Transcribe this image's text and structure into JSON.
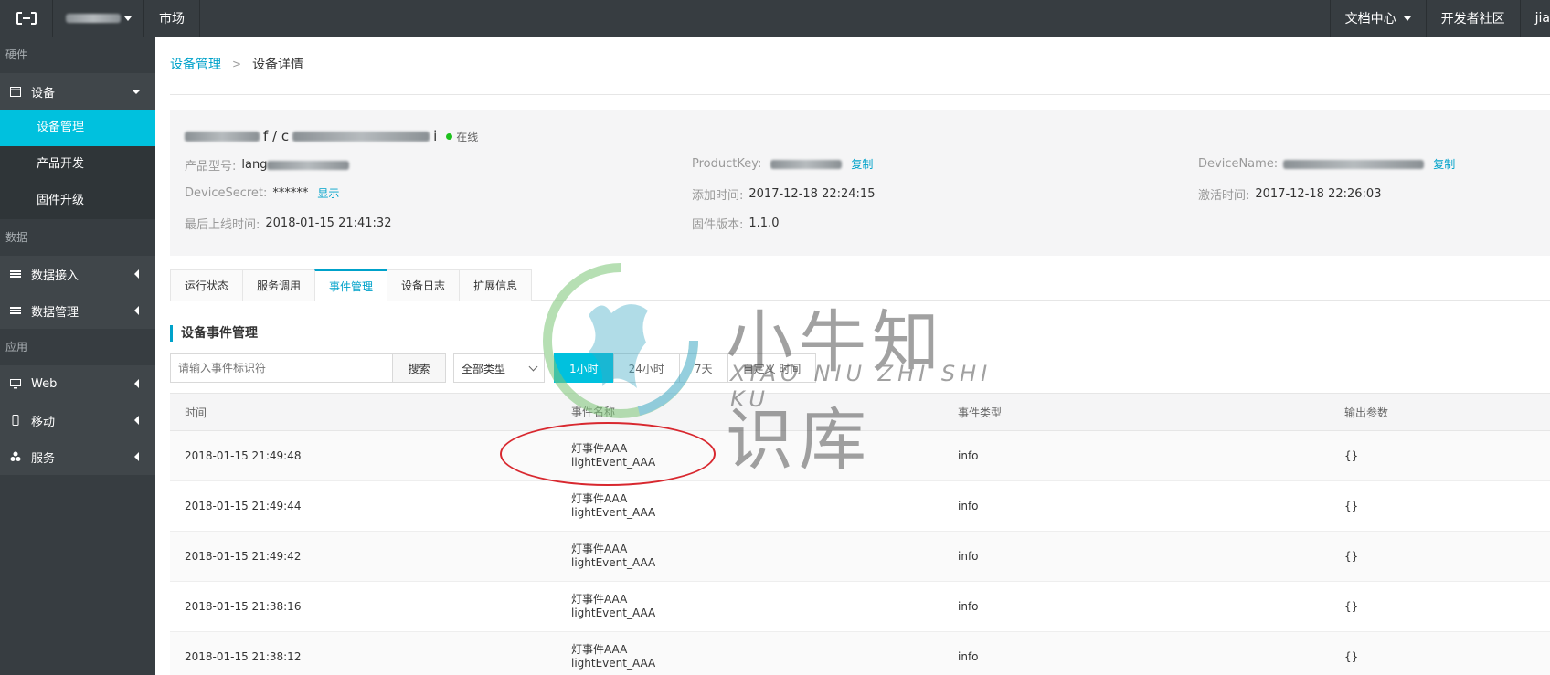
{
  "topbar": {
    "market": "市场",
    "docs": "文档中心",
    "community": "开发者社区",
    "user": "jia"
  },
  "sidebar": {
    "section_hardware": "硬件",
    "device": "设备",
    "device_mgmt": "设备管理",
    "product_dev": "产品开发",
    "firmware": "固件升级",
    "section_data": "数据",
    "data_access": "数据接入",
    "data_mgmt": "数据管理",
    "section_app": "应用",
    "web": "Web",
    "mobile": "移动",
    "service": "服务"
  },
  "breadcrumb": {
    "parent": "设备管理",
    "current": "设备详情"
  },
  "device": {
    "title_mid": "f / c",
    "title_end": "i",
    "status": "在线",
    "product_model_label": "产品型号:",
    "product_model_value": "lang",
    "product_key_label": "ProductKey:",
    "copy": "复制",
    "device_name_label": "DeviceName:",
    "secret_label": "DeviceSecret:",
    "secret_value": "******",
    "show": "显示",
    "added_label": "添加时间:",
    "added_value": "2017-12-18 22:24:15",
    "activated_label": "激活时间:",
    "activated_value": "2017-12-18 22:26:03",
    "last_online_label": "最后上线时间:",
    "last_online_value": "2018-01-15 21:41:32",
    "firmware_label": "固件版本:",
    "firmware_value": "1.1.0"
  },
  "tabs": [
    "运行状态",
    "服务调用",
    "事件管理",
    "设备日志",
    "扩展信息"
  ],
  "section_title": "设备事件管理",
  "toolbar": {
    "search_placeholder": "请输入事件标识符",
    "search_btn": "搜索",
    "type_select": "全部类型",
    "ranges": [
      "1小时",
      "24小时",
      "7天",
      "自定义 时间"
    ]
  },
  "table": {
    "headers": [
      "时间",
      "事件名称",
      "事件类型",
      "输出参数"
    ],
    "rows": [
      {
        "time": "2018-01-15 21:49:48",
        "name": "灯事件AAA",
        "id": "lightEvent_AAA",
        "type": "info",
        "out": "{}"
      },
      {
        "time": "2018-01-15 21:49:44",
        "name": "灯事件AAA",
        "id": "lightEvent_AAA",
        "type": "info",
        "out": "{}"
      },
      {
        "time": "2018-01-15 21:49:42",
        "name": "灯事件AAA",
        "id": "lightEvent_AAA",
        "type": "info",
        "out": "{}"
      },
      {
        "time": "2018-01-15 21:38:16",
        "name": "灯事件AAA",
        "id": "lightEvent_AAA",
        "type": "info",
        "out": "{}"
      },
      {
        "time": "2018-01-15 21:38:12",
        "name": "灯事件AAA",
        "id": "lightEvent_AAA",
        "type": "info",
        "out": "{}"
      }
    ]
  },
  "watermark": {
    "title": "小牛知识库",
    "subtitle": "XIAO NIU ZHI SHI KU"
  },
  "colors": {
    "accent": "#00c1de",
    "link": "#00a2ca",
    "sidebar_bg": "#373d41",
    "annotation": "#d8282f",
    "online": "#1dc11d"
  }
}
